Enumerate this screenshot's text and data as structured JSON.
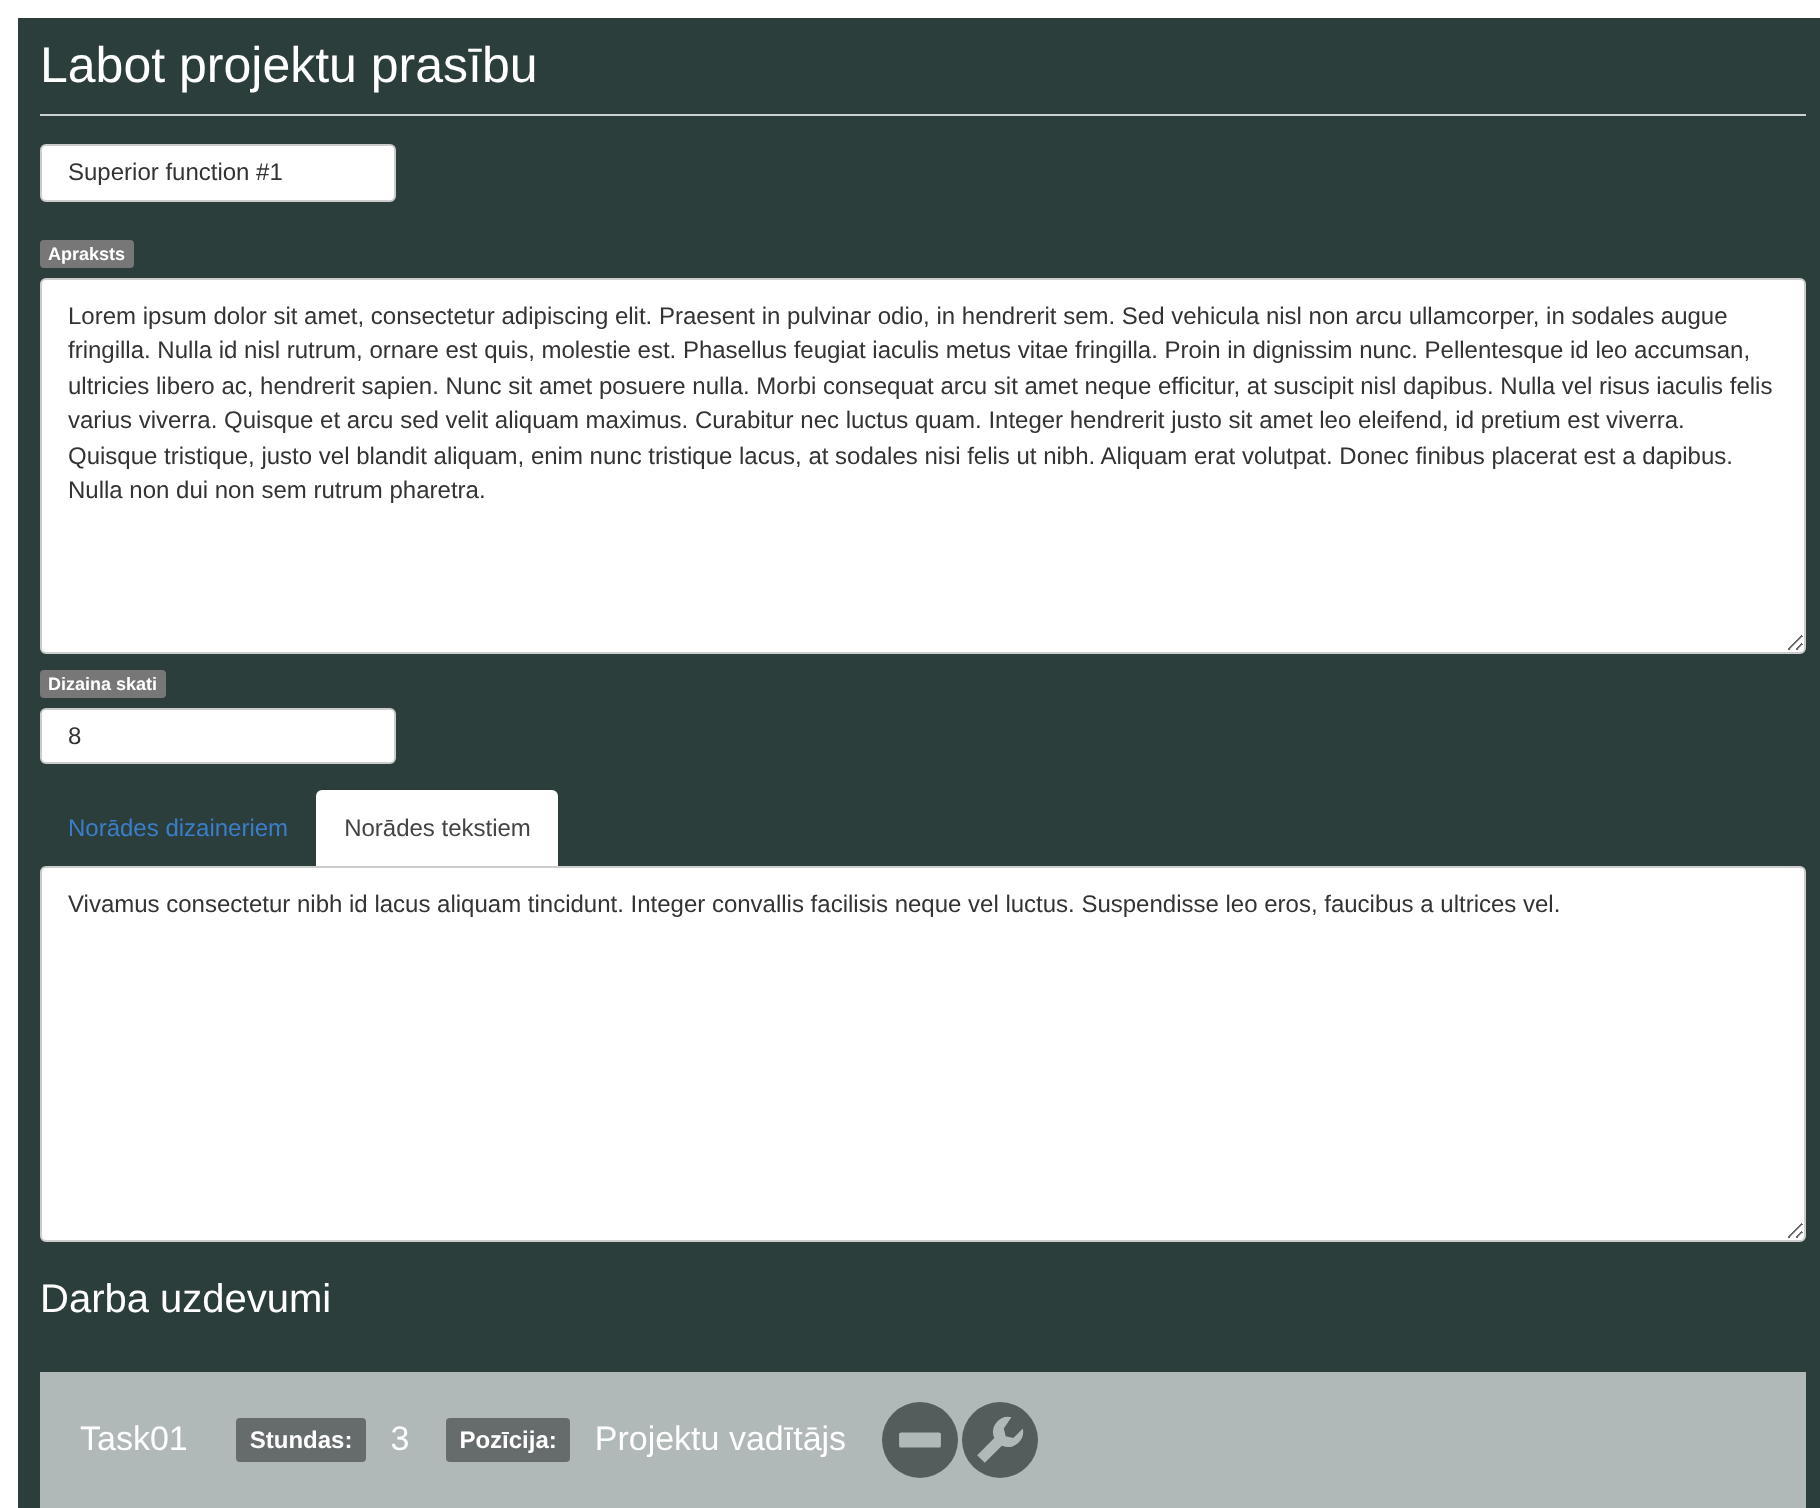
{
  "page": {
    "title": "Labot projektu prasību"
  },
  "name_field": {
    "value": "Superior function #1"
  },
  "description": {
    "label": "Apraksts",
    "value": "Lorem ipsum dolor sit amet, consectetur adipiscing elit. Praesent in pulvinar odio, in hendrerit sem. Sed vehicula nisl non arcu ullamcorper, in sodales augue fringilla. Nulla id nisl rutrum, ornare est quis, molestie est. Phasellus feugiat iaculis metus vitae fringilla. Proin in dignissim nunc. Pellentesque id leo accumsan, ultricies libero ac, hendrerit sapien. Nunc sit amet posuere nulla. Morbi consequat arcu sit amet neque efficitur, at suscipit nisl dapibus. Nulla vel risus iaculis felis varius viverra. Quisque et arcu sed velit aliquam maximus. Curabitur nec luctus quam. Integer hendrerit justo sit amet leo eleifend, id pretium est viverra. Quisque tristique, justo vel blandit aliquam, enim nunc tristique lacus, at sodales nisi felis ut nibh. Aliquam erat volutpat. Donec finibus placerat est a dapibus. Nulla non dui non sem rutrum pharetra."
  },
  "design_views": {
    "label": "Dizaina skati",
    "value": "8"
  },
  "tabs": [
    {
      "label": "Norādes dizaineriem",
      "selected": false
    },
    {
      "label": "Norādes tekstiem",
      "selected": true
    }
  ],
  "notes": {
    "value": "Vivamus consectetur nibh id lacus aliquam tincidunt. Integer convallis facilisis neque vel luctus. Suspendisse leo eros, faucibus a ultrices vel."
  },
  "tasks_heading": "Darba uzdevumi",
  "tasks": [
    {
      "name": "Task01",
      "hours_label": "Stundas:",
      "hours": "3",
      "position_label": "Pozīcija:",
      "position": "Projektu vadītājs"
    }
  ]
}
